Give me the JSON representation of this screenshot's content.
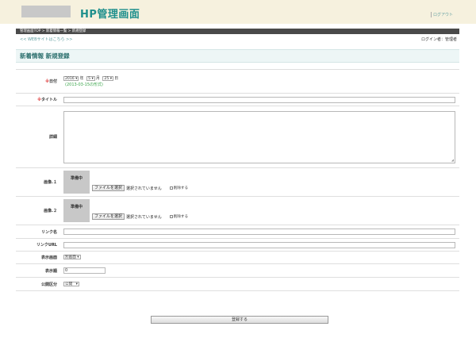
{
  "header": {
    "title": "HP管理画面",
    "logout_label": "ログアウト"
  },
  "breadcrumb": {
    "items": [
      "管理画面TOP",
      ">",
      "新着情報一覧",
      ">",
      "新規登録"
    ]
  },
  "subnav": {
    "web_link": "<< WEBサイトはこちら >>",
    "login_info": "ログイン者：管理者"
  },
  "page": {
    "heading": "新着情報 新規登録"
  },
  "form": {
    "date": {
      "required_mark": "※",
      "label": "日付",
      "year_value": "2016",
      "year_unit": "年",
      "month_value": "5",
      "month_unit": "月",
      "day_value": "25",
      "day_unit": "日",
      "hint": "(2013-03-15の形式)"
    },
    "title_field": {
      "required_mark": "※",
      "label": "タイトル",
      "value": ""
    },
    "detail": {
      "label": "詳細",
      "value": ""
    },
    "image1": {
      "label": "画像.１",
      "placeholder": "準備中",
      "file_button": "ファイルを選択",
      "file_status": "選択されていません",
      "delete_label": "削除する"
    },
    "image2": {
      "label": "画像.２",
      "placeholder": "準備中",
      "file_button": "ファイルを選択",
      "file_status": "選択されていません",
      "delete_label": "削除する"
    },
    "link_name": {
      "label": "リンク名",
      "value": ""
    },
    "link_url": {
      "label": "リンクURL",
      "value": ""
    },
    "display_screen": {
      "label": "表示画面",
      "value": "別画面"
    },
    "display_order": {
      "label": "表示順",
      "value": "0"
    },
    "publish": {
      "label": "公開区分",
      "value": "公開"
    }
  },
  "submit": {
    "label": "登録する"
  }
}
